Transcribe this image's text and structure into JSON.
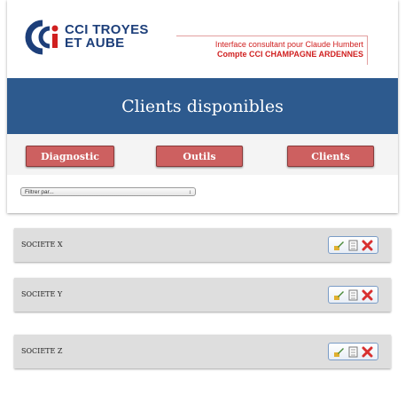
{
  "header": {
    "logo_text_line1": "CCI TROYES",
    "logo_text_line2": "ET AUBE",
    "consultant_line": "Interface consultant pour Claude Humbert",
    "account_line": "Compte CCI CHAMPAGNE ARDENNES"
  },
  "page_title": "Clients disponibles",
  "nav": {
    "diagnostic": "Diagnostic",
    "outils": "Outils",
    "clients": "Clients"
  },
  "filter": {
    "selected": "Filtrer par...",
    "arrow": "↕"
  },
  "clients": [
    {
      "name": "SOCIETE X"
    },
    {
      "name": "SOCIETE Y"
    },
    {
      "name": "SOCIETE Z"
    }
  ],
  "colors": {
    "brand_blue": "#2d5a8e",
    "logo_blue": "#1d3f7a",
    "nav_button": "#cd6060",
    "consultant_red": "#d02020",
    "row_bg": "#dedede"
  },
  "icons": {
    "row_actions": [
      "edit-icon",
      "document-icon",
      "delete-icon"
    ]
  }
}
